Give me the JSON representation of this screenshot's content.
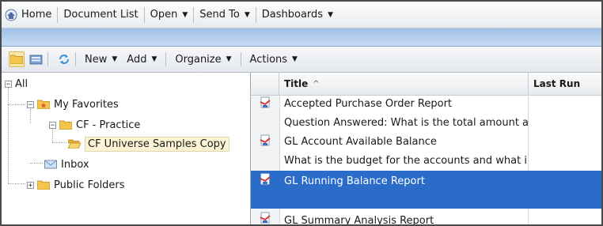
{
  "menubar": {
    "items": [
      {
        "label": "Home",
        "icon": "home-icon"
      },
      {
        "label": "Document List"
      },
      {
        "label": "Open",
        "dropdown": true
      },
      {
        "label": "Send To",
        "dropdown": true
      },
      {
        "label": "Dashboards",
        "dropdown": true
      }
    ]
  },
  "toolbar": {
    "new_label": "New",
    "add_label": "Add",
    "organize_label": "Organize",
    "actions_label": "Actions"
  },
  "tree": {
    "all": "All",
    "my_favorites": "My Favorites",
    "cf_practice": "CF - Practice",
    "cf_universe": "CF Universe Samples Copy",
    "inbox": "Inbox",
    "public_folders": "Public Folders"
  },
  "list": {
    "col_title": "Title",
    "col_last_run": "Last Run",
    "sort_indicator": "^",
    "rows": [
      {
        "title": "Accepted Purchase Order Report"
      },
      {
        "title": "Question Answered: What is the total amount a"
      },
      {
        "title": "GL Account Available Balance"
      },
      {
        "title": "What is the budget for the accounts and what i"
      },
      {
        "title": "GL Running Balance Report"
      },
      {
        "title": "GL Summary Analysis Report"
      }
    ]
  },
  "colors": {
    "selection": "#2b6cc9",
    "band": "#b5cfee",
    "folder": "#f3c54a"
  }
}
